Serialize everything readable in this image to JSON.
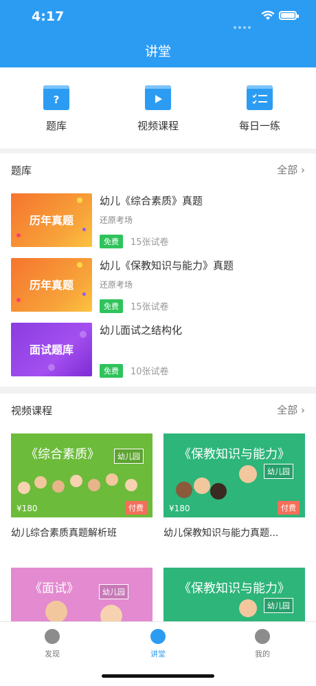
{
  "status_bar": {
    "time": "4:17"
  },
  "header": {
    "title": "讲堂"
  },
  "quick_entries": [
    {
      "label": "题库",
      "icon": "question-icon"
    },
    {
      "label": "视频课程",
      "icon": "play-icon"
    },
    {
      "label": "每日一练",
      "icon": "checklist-icon"
    }
  ],
  "question_bank": {
    "title": "题库",
    "more": "全部",
    "items": [
      {
        "thumb_text": "历年真题",
        "name": "幼儿《综合素质》真题",
        "sub": "还原考场",
        "badge": "免费",
        "count": "15张试卷"
      },
      {
        "thumb_text": "历年真题",
        "name": "幼儿《保教知识与能力》真题",
        "sub": "还原考场",
        "badge": "免费",
        "count": "15张试卷"
      },
      {
        "thumb_text": "面试题库",
        "name": "幼儿面试之结构化",
        "sub": "",
        "badge": "免费",
        "count": "10张试卷"
      }
    ]
  },
  "video_courses": {
    "title": "视频课程",
    "more": "全部",
    "items": [
      {
        "title_text": "《综合素质》",
        "tag": "幼儿园",
        "price": "¥180",
        "paid": "付费",
        "name": "幼儿综合素质真题解析班"
      },
      {
        "title_text": "《保教知识与能力》",
        "tag": "幼儿园",
        "price": "¥180",
        "paid": "付费",
        "name": "幼儿保教知识与能力真题..."
      },
      {
        "title_text": "《面试》",
        "tag": "幼儿园"
      },
      {
        "title_text": "《保教知识与能力》",
        "tag": "幼儿园"
      }
    ]
  },
  "tabbar": [
    {
      "label": "发现",
      "icon": "compass-icon",
      "active": false
    },
    {
      "label": "讲堂",
      "icon": "play-circle-icon",
      "active": true
    },
    {
      "label": "我的",
      "icon": "profile-icon",
      "active": false
    }
  ],
  "colors": {
    "primary": "#2c9cf3",
    "free": "#2fc35b",
    "paid": "#f36f5a"
  }
}
